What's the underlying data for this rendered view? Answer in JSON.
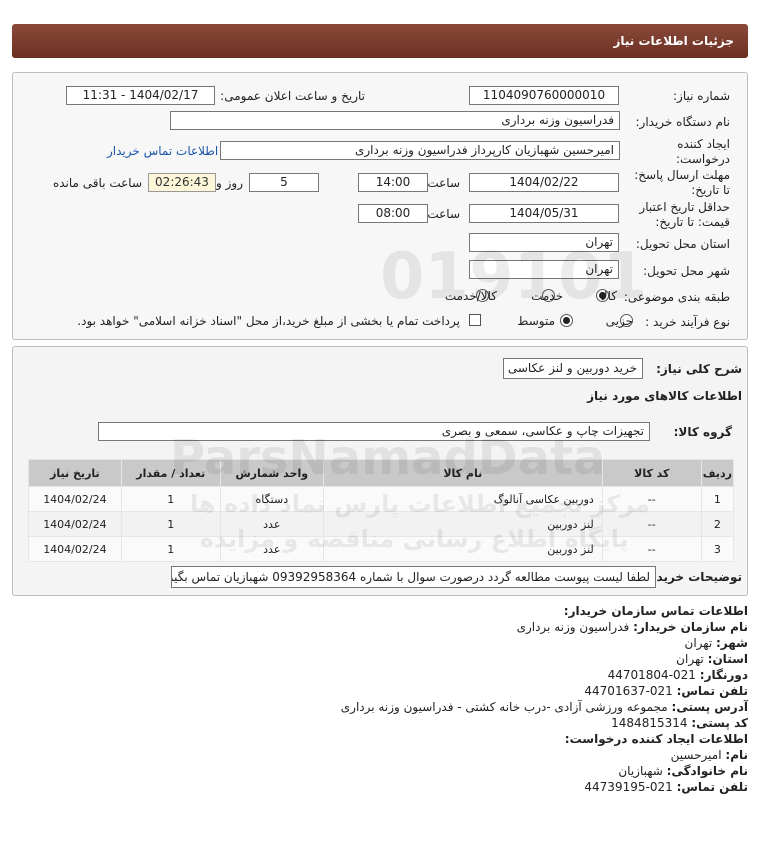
{
  "header": {
    "title": "جزئیات اطلاعات نیاز"
  },
  "form": {
    "need_number_label": "شماره نیاز:",
    "need_number": "1104090760000010",
    "announce_label": "تاریخ و ساعت اعلان عمومی:",
    "announce_value": "1404/02/17 - 11:31",
    "buyer_org_label": "نام دستگاه خریدار:",
    "buyer_org": "فدراسیون وزنه برداری",
    "requester_label": "ایجاد کننده درخواست:",
    "requester": "امیرحسین شهبازیان کارپرداز فدراسیون وزنه برداری",
    "contact_link": "اطلاعات تماس خریدار",
    "deadline_label": "مهلت ارسال پاسخ: تا تاریخ:",
    "deadline_date": "1404/02/22",
    "time_label": "ساعت",
    "deadline_time": "14:00",
    "days_value": "5",
    "days_label": "روز و",
    "countdown": "02:26:43",
    "remaining_label": "ساعت باقی مانده",
    "validity_label": "حداقل تاریخ اعتبار قیمت: تا تاریخ:",
    "validity_date": "1404/05/31",
    "validity_time": "08:00",
    "province_label": "استان محل تحویل:",
    "province": "تهران",
    "city_label": "شهر محل تحویل:",
    "city": "تهران",
    "category_label": "طبقه بندی موضوعی:",
    "category_options": [
      "کالا",
      "خدمت",
      "کالا/خدمت"
    ],
    "category_selected": "کالا",
    "process_label": "نوع فرآیند خرید :",
    "process_options": [
      "جزیی",
      "متوسط"
    ],
    "process_selected": "متوسط",
    "payment_note": "پرداخت تمام یا بخشی از مبلغ خرید،از محل \"اسناد خزانه اسلامی\" خواهد بود."
  },
  "details": {
    "summary_label": "شرح کلی نیاز:",
    "summary": "خرید دوربین و لنز عکاسی",
    "goods_info_title": "اطلاعات کالاهای مورد نیاز",
    "group_label": "گروه کالا:",
    "group_value": "تجهیزات چاپ و عکاسی، سمعی و بصری",
    "table": {
      "headers": [
        "ردیف",
        "کد کالا",
        "نام کالا",
        "واحد شمارش",
        "تعداد / مقدار",
        "تاریخ نیاز"
      ],
      "rows": [
        [
          "1",
          "--",
          "دوربین عکاسی آنالوگ",
          "دستگاه",
          "1",
          "1404/02/24"
        ],
        [
          "2",
          "--",
          "لنز دوربین",
          "عدد",
          "1",
          "1404/02/24"
        ],
        [
          "3",
          "--",
          "لنز دوربین",
          "عدد",
          "1",
          "1404/02/24"
        ]
      ]
    },
    "buyer_notes_label": "توضیحات خریدار:",
    "buyer_notes": "لطفا لیست پیوست مطالعه گردد درصورت سوال با شماره 09392958364 شهبازیان تماس بگیرید"
  },
  "contact": {
    "title": "اطلاعات تماس سازمان خریدار:",
    "org_label": "نام سازمان خریدار:",
    "org": "فدراسیون وزنه برداری",
    "city_label": "شهر:",
    "city": "تهران",
    "province_label": "استان:",
    "province": "تهران",
    "fax_label": "دورنگار:",
    "fax": "021-44701804",
    "phone_label": "تلفن تماس:",
    "phone": "021-44701637",
    "address_label": "آدرس پستی:",
    "address": "مجموعه ورزشی آزادی -درب خانه کشتی - فدراسیون وزنه برداری",
    "postal_label": "کد پستی:",
    "postal": "1484815314",
    "creator_title": "اطلاعات ایجاد کننده درخواست:",
    "name_label": "نام:",
    "name": "امیرحسین",
    "family_label": "نام خانوادگی:",
    "family": "شهبازیان",
    "creator_phone_label": "تلفن تماس:",
    "creator_phone": "021-44739195"
  },
  "watermark": {
    "number": "019101",
    "brand": "ParsNamadData",
    "line1": "مرکز تجمیع اطلاعات پارس نماد داده ها",
    "line2": "پایگاه اطلاع رسانی مناقصه و مزایده"
  }
}
